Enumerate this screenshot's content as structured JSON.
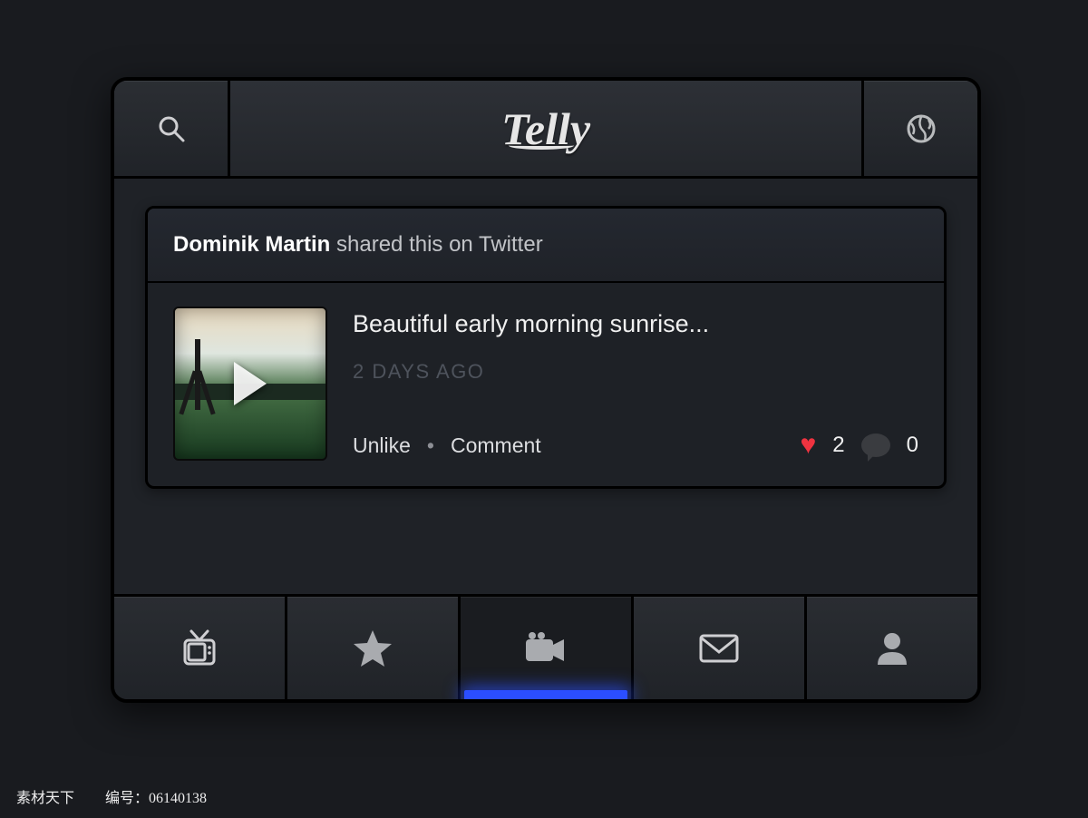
{
  "header": {
    "brand": "Telly",
    "search_icon": "search-icon",
    "globe_icon": "globe-icon"
  },
  "feed": {
    "author": "Dominik Martin",
    "share_text": " shared this on Twitter",
    "title": "Beautiful early morning sunrise...",
    "timestamp": "2 DAYS AGO",
    "unlike_label": "Unlike",
    "comment_label": "Comment",
    "likes": "2",
    "comments": "0"
  },
  "nav": {
    "items": [
      "tv",
      "star",
      "camera",
      "mail",
      "profile"
    ],
    "active_index": 2
  },
  "watermark": {
    "site": "素材天下 ",
    "code_label": "编号：",
    "code": "06140138"
  }
}
